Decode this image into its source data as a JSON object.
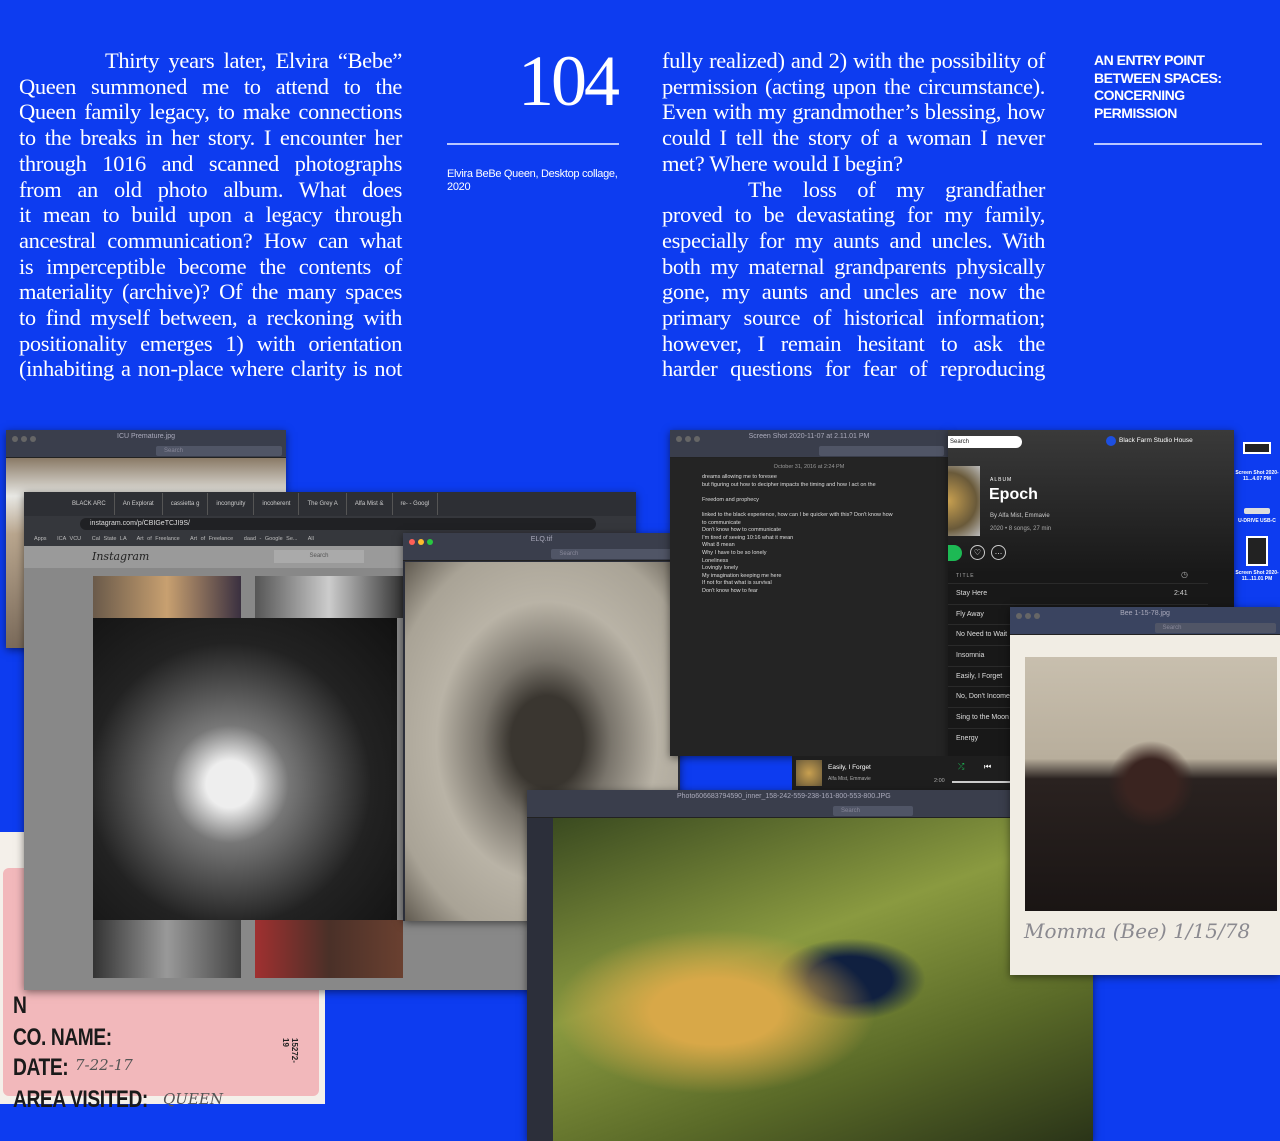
{
  "page_number": "104",
  "caption": "Elvira BeBe Queen, Desktop collage, 2020",
  "heading": "AN ENTRY POINT BETWEEN SPACES: CONCERNING PERMISSION",
  "left_column": [
    "Thirty years later, Elvira “Bebe”",
    "Queen summoned me to attend to the",
    "Queen family legacy, to make connections",
    "to the breaks in her story. I encounter her",
    "through 1016 and scanned photographs",
    "from an old photo album. What does",
    "it mean to build upon a legacy through",
    "ancestral communication? How can what",
    "is imperceptible become the contents of",
    "materiality (archive)? Of the many spaces",
    "to find myself between, a reckoning with",
    "positionality emerges 1) with orientation",
    "(inhabiting a non-place where clarity is not"
  ],
  "right_column": [
    "fully realized) and 2) with the possibility of",
    "permission (acting upon the circumstance).",
    "Even with my grandmother’s blessing, how",
    "could I tell the story of a woman I never",
    "met? Where would I begin?",
    "The loss of my grandfather",
    "proved to be devastating for my family,",
    "especially for my aunts and uncles. With",
    "both my maternal grandparents physically",
    "gone, my aunts and uncles are now the",
    "primary source of historical information;",
    "however, I remain hesitant to ask the",
    "harder questions for fear of reproducing"
  ],
  "collage": {
    "icu_window": {
      "title": "ICU Premature.jpg",
      "search": "Search"
    },
    "browser": {
      "tabs": [
        "BLACK ARC",
        "An Explorat",
        "cassietta g",
        "incongruity",
        "incoherent",
        "The Grey A",
        "Alfa Mist &",
        "re- - Googl"
      ],
      "url": "instagram.com/p/CBIGeTCJI9S/",
      "bookmarks": [
        "Apps",
        "ICA VCU",
        "Cal State LA",
        "Art of Freelance",
        "Art of Freelance",
        "daad - Google Se...",
        "All"
      ],
      "brand": "Instagram",
      "search": "Search"
    },
    "elq_window": {
      "title": "ELQ.tif",
      "search": "Search"
    },
    "notes_window": {
      "title": "Screen Shot 2020-11-07 at 2.11.01 PM",
      "date": "October 31, 2016 at 2:24 PM",
      "lines": [
        "dreams allowing me to foresee",
        "but figuring out how to decipher impacts the timing and how I act on the",
        "",
        "Freedom and prophecy",
        "",
        "linked to the black experience, how can I be quicker with this? Don't know how",
        "to communicate",
        "Don't know how to communicate",
        "I'm tired of seeing 10:16 what it mean",
        "What 8 mean",
        "Why I have to be so lonely",
        "Loneliness",
        "Lovingly lonely",
        "My imagination keeping me here",
        "If not for that what is survival",
        "Don't know how to fear"
      ]
    },
    "spotify": {
      "search": "Search",
      "user": "Black Farm Studio House",
      "type": "ALBUM",
      "album": "Epoch",
      "artists": "By Alfa Mist, Emmavie",
      "meta": "2020 • 8 songs, 27 min",
      "title_header": "TITLE",
      "tracks": [
        "Stay Here",
        "Fly Away",
        "No Need to Wait",
        "Insomnia",
        "Easily, I Forget",
        "No, Don't Income",
        "Sing to the Moon",
        "Energy"
      ],
      "first_duration": "2:41",
      "now_playing": "Easily, I Forget",
      "now_artist": "Alfa Mist, Emmavie",
      "elapsed": "2:00",
      "accent": "#1db954"
    },
    "desktop_icons": [
      "Screen Shot 2020-11...4.07 PM",
      "U-DRIVE USB-C",
      "Screen Shot 2020-11...11.01 PM"
    ],
    "bee_window": {
      "title": "Bee 1-15-78.jpg",
      "search": "Search",
      "inscription": "Momma (Bee) 1/15/78"
    },
    "photo_window": {
      "title": "Photo606683794590_inner_158-242-559-238-161-800-553-800.JPG",
      "search": "Search"
    },
    "visitor_card": {
      "line_partial": "N",
      "co_name": "CO. NAME:",
      "date_label": "DATE:",
      "date_value": "7-22-17",
      "area_label": "AREA VISITED:",
      "area_value": "QUEEN",
      "serial": "15272-19"
    }
  }
}
